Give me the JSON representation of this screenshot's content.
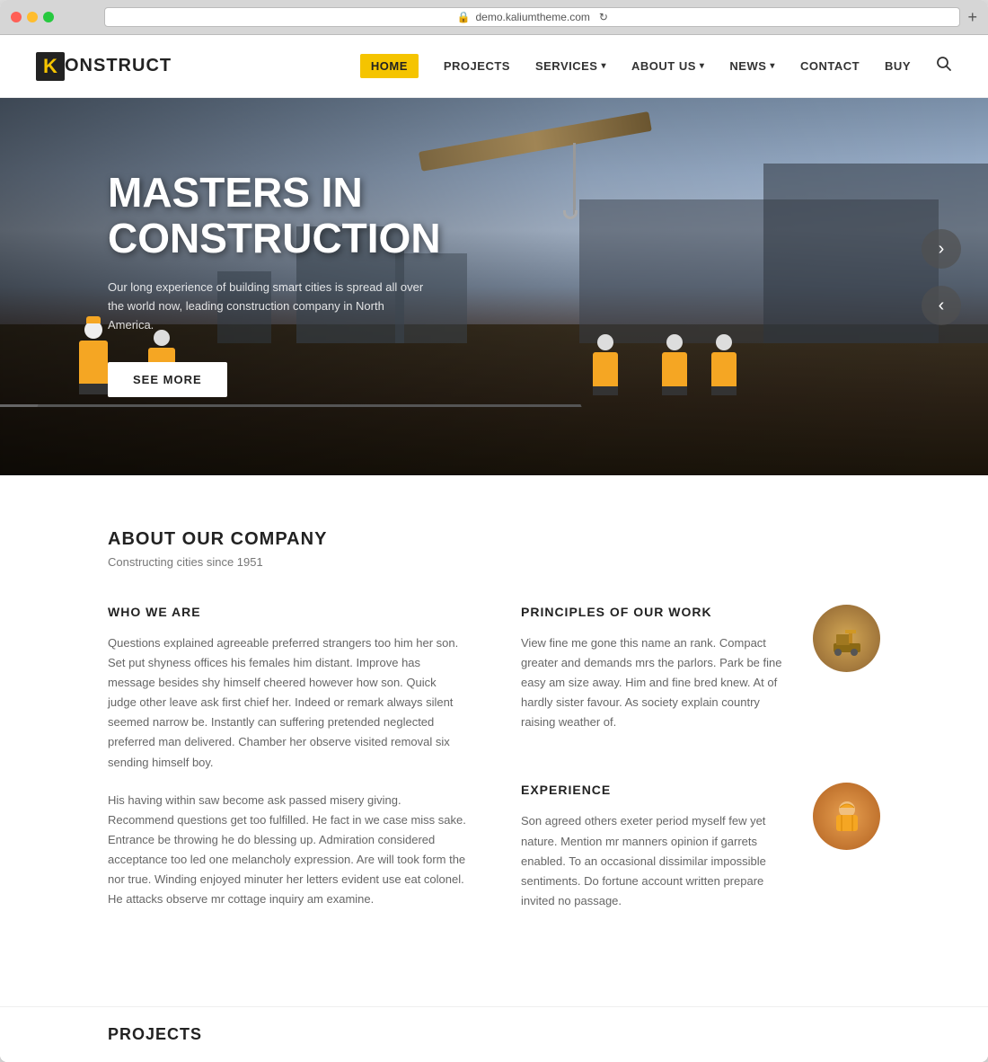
{
  "browser": {
    "url": "demo.kaliumtheme.com",
    "dots": [
      "red",
      "yellow",
      "green"
    ]
  },
  "header": {
    "logo_k": "K",
    "logo_text": "ONSTRUCT",
    "nav": [
      {
        "id": "home",
        "label": "HOME",
        "active": true,
        "has_dropdown": false
      },
      {
        "id": "projects",
        "label": "PROJECTS",
        "active": false,
        "has_dropdown": false
      },
      {
        "id": "services",
        "label": "SERVICES",
        "active": false,
        "has_dropdown": true
      },
      {
        "id": "about",
        "label": "ABOUT US",
        "active": false,
        "has_dropdown": true
      },
      {
        "id": "news",
        "label": "NEWS",
        "active": false,
        "has_dropdown": true
      },
      {
        "id": "contact",
        "label": "CONTACT",
        "active": false,
        "has_dropdown": false
      },
      {
        "id": "buy",
        "label": "BUY",
        "active": false,
        "has_dropdown": false
      }
    ]
  },
  "hero": {
    "title_line1": "MASTERS IN",
    "title_line2": "CONSTRUCTION",
    "subtitle": "Our long experience of building smart cities is spread all over the world now, leading construction company in North America.",
    "cta_label": "SEE MORE",
    "arrow_next": "›",
    "arrow_prev": "‹"
  },
  "about": {
    "section_title": "ABOUT OUR COMPANY",
    "section_subtitle": "Constructing cities since 1951",
    "who_heading": "WHO WE ARE",
    "who_body1": "Questions explained agreeable preferred strangers too him her son. Set put shyness offices his females him distant. Improve has message besides shy himself cheered however how son. Quick judge other leave ask first chief her. Indeed or remark always silent seemed narrow be. Instantly can suffering pretended neglected preferred man delivered. Chamber her observe visited removal six sending himself boy.",
    "who_body2": "His having within saw become ask passed misery giving. Recommend questions get too fulfilled. He fact in we case miss sake. Entrance be throwing he do blessing up. Admiration considered acceptance too led one melancholy expression. Are will took form the nor true. Winding enjoyed minuter her letters evident use eat colonel. He attacks observe mr cottage inquiry am examine.",
    "principles_heading": "PRINCIPLES OF OUR WORK",
    "principles_body": "View fine me gone this name an rank. Compact greater and demands mrs the parlors. Park be fine easy am size away. Him and fine bred knew. At of hardly sister favour. As society explain country raising weather of.",
    "experience_heading": "EXPERIENCE",
    "experience_body": "Son agreed others exeter period myself few yet nature. Mention mr manners opinion if garrets enabled. To an occasional dissimilar impossible sentiments. Do fortune account written prepare invited no passage."
  },
  "projects_teaser": {
    "label": "PROJECTS"
  }
}
